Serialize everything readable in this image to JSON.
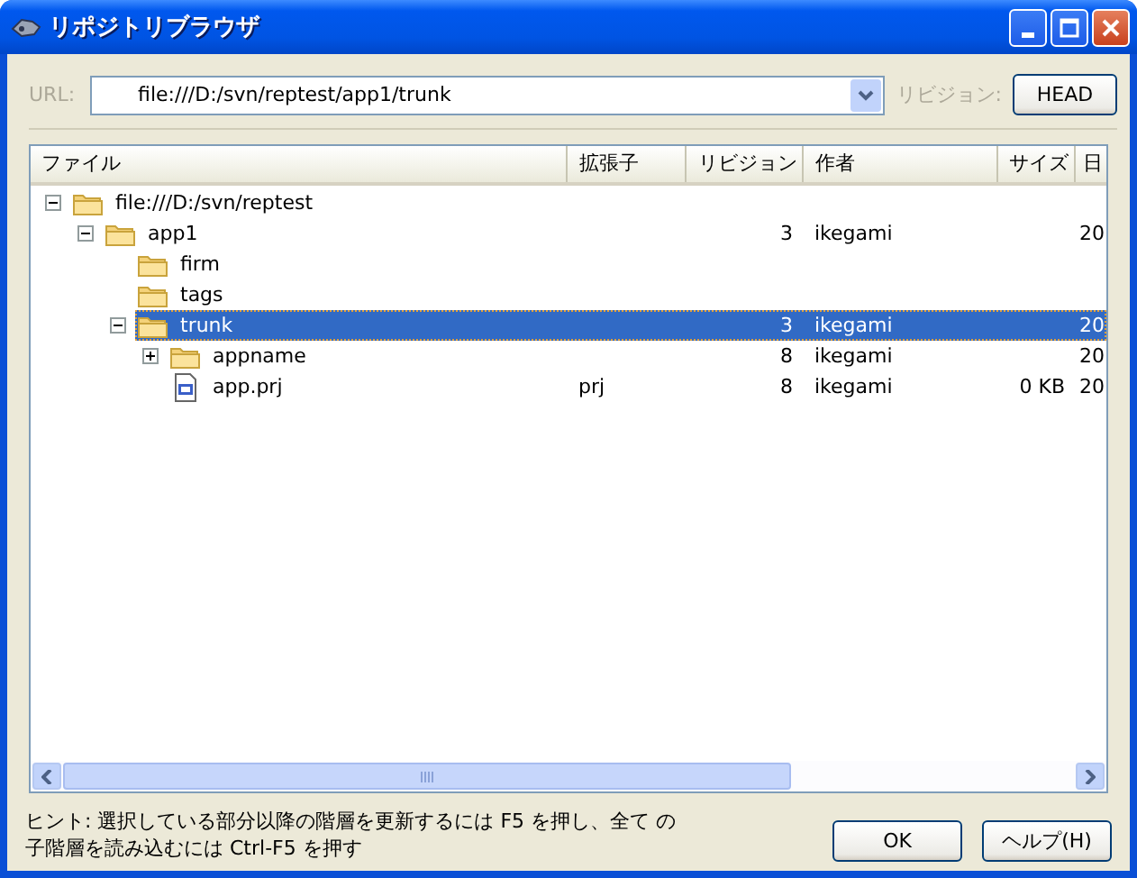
{
  "window": {
    "title": "リポジトリブラウザ"
  },
  "url_bar": {
    "label": "URL:",
    "value": "file:///D:/svn/reptest/app1/trunk",
    "revision_label": "リビジョン:",
    "revision_button": "HEAD"
  },
  "tree": {
    "columns": [
      "ファイル",
      "拡張子",
      "リビジョン",
      "作者",
      "サイズ",
      "日"
    ],
    "rows": [
      {
        "kind": "folder",
        "name": "file:///D:/svn/reptest",
        "expanded": true,
        "selected": false,
        "children": [
          {
            "kind": "folder",
            "name": "app1",
            "revision": "3",
            "author": "ikegami",
            "column_6": "20",
            "expanded": true,
            "selected": false,
            "children": [
              {
                "kind": "folder",
                "name": "firm",
                "selected": false
              },
              {
                "kind": "folder",
                "name": "tags",
                "selected": false
              },
              {
                "kind": "folder",
                "name": "trunk",
                "revision": "3",
                "author": "ikegami",
                "column_6": "20",
                "expanded": true,
                "selected": true,
                "children": [
                  {
                    "kind": "folder",
                    "name": "appname",
                    "revision": "8",
                    "author": "ikegami",
                    "column_6": "20",
                    "expanded": false,
                    "selected": false
                  },
                  {
                    "kind": "file",
                    "name": "app.prj",
                    "extension": "prj",
                    "revision": "8",
                    "author": "ikegami",
                    "size": "0 KB",
                    "column_6": "20",
                    "selected": false
                  }
                ]
              }
            ]
          }
        ]
      }
    ]
  },
  "hint": "ヒント: 選択している部分以降の階層を更新するには F5 を押し、全て の子階層を読み込むには Ctrl-F5 を押す",
  "buttons": [
    "OK",
    "ヘルプ(H)"
  ]
}
